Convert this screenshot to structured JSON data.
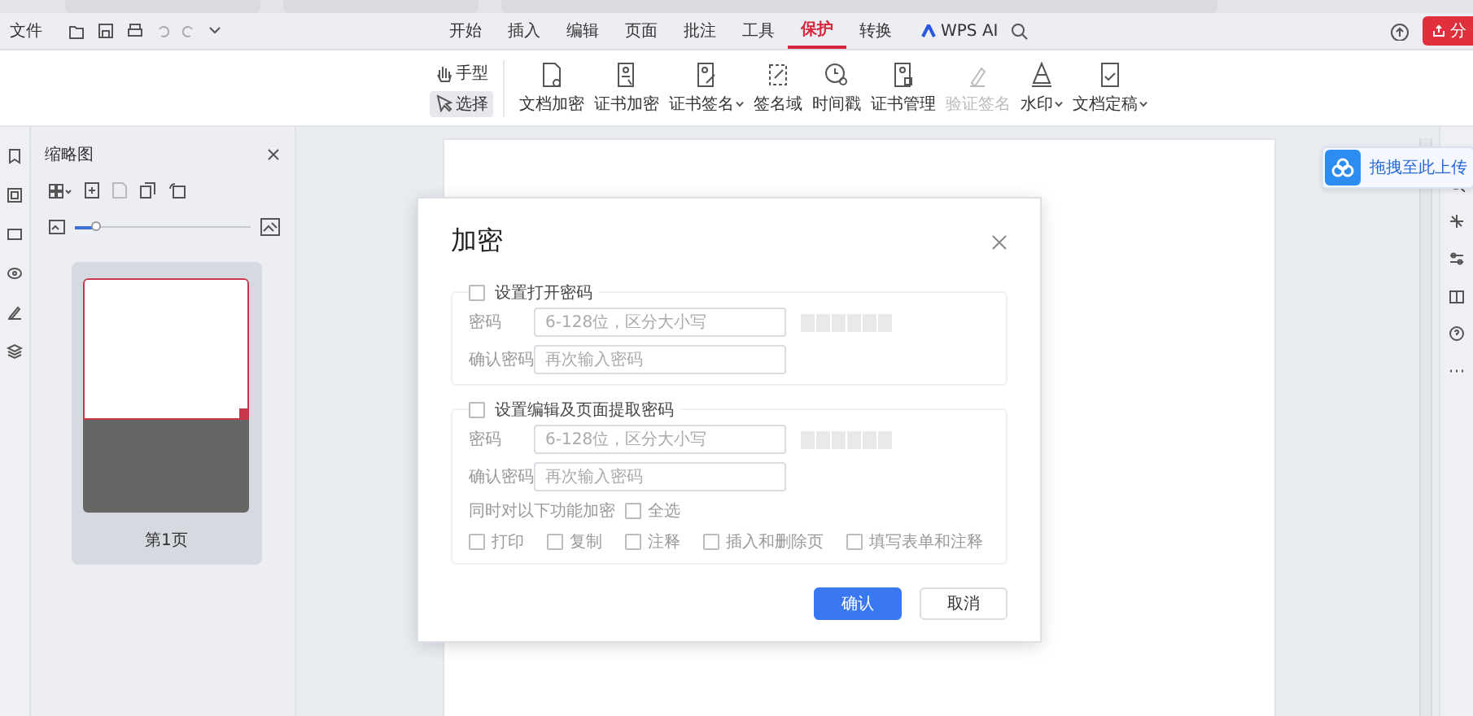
{
  "menubar": {
    "file_label": "文件",
    "tabs": [
      {
        "label": "开始",
        "selected": false
      },
      {
        "label": "插入",
        "selected": false
      },
      {
        "label": "编辑",
        "selected": false
      },
      {
        "label": "页面",
        "selected": false
      },
      {
        "label": "批注",
        "selected": false
      },
      {
        "label": "工具",
        "selected": false
      },
      {
        "label": "保护",
        "selected": true
      },
      {
        "label": "转换",
        "selected": false
      }
    ],
    "ai_label": "WPS AI",
    "share_label": "分"
  },
  "ribbon": {
    "modes": [
      {
        "label": "手型",
        "selected": false
      },
      {
        "label": "选择",
        "selected": true
      }
    ],
    "tools": [
      {
        "label": "文档加密",
        "dropdown": false,
        "disabled": false
      },
      {
        "label": "证书加密",
        "dropdown": false,
        "disabled": false
      },
      {
        "label": "证书签名",
        "dropdown": true,
        "disabled": false
      },
      {
        "label": "签名域",
        "dropdown": false,
        "disabled": false
      },
      {
        "label": "时间戳",
        "dropdown": false,
        "disabled": false
      },
      {
        "label": "证书管理",
        "dropdown": false,
        "disabled": false
      },
      {
        "label": "验证签名",
        "dropdown": false,
        "disabled": true
      },
      {
        "label": "水印",
        "dropdown": true,
        "disabled": false
      },
      {
        "label": "文档定稿",
        "dropdown": true,
        "disabled": false
      }
    ]
  },
  "sidebar": {
    "title": "缩略图",
    "zoom": {
      "level": 0.12
    },
    "pages": [
      {
        "label": "第1页",
        "selected": true
      }
    ]
  },
  "upload_tip": {
    "label": "拖拽至此上传"
  },
  "dialog": {
    "title": "加密",
    "sections": [
      {
        "label": "设置打开密码",
        "checked": false,
        "fields": [
          {
            "label": "密码",
            "placeholder": "6-128位，区分大小写",
            "strength": {
              "level": 0
            }
          },
          {
            "label": "确认密码",
            "placeholder": "再次输入密码"
          }
        ]
      },
      {
        "label": "设置编辑及页面提取密码",
        "checked": false,
        "fields": [
          {
            "label": "密码",
            "placeholder": "6-128位，区分大小写",
            "strength": {
              "level": 0
            }
          },
          {
            "label": "确认密码",
            "placeholder": "再次输入密码"
          }
        ],
        "scope_label": "同时对以下功能加密",
        "select_all": {
          "label": "全选",
          "checked": false
        },
        "options": [
          {
            "label": "打印",
            "checked": false
          },
          {
            "label": "复制",
            "checked": false
          },
          {
            "label": "注释",
            "checked": false
          },
          {
            "label": "插入和删除页",
            "checked": false
          },
          {
            "label": "填写表单和注释",
            "checked": false
          }
        ]
      }
    ],
    "buttons": [
      {
        "label": "确认",
        "kind": "primary"
      },
      {
        "label": "取消",
        "kind": "secondary"
      }
    ]
  }
}
